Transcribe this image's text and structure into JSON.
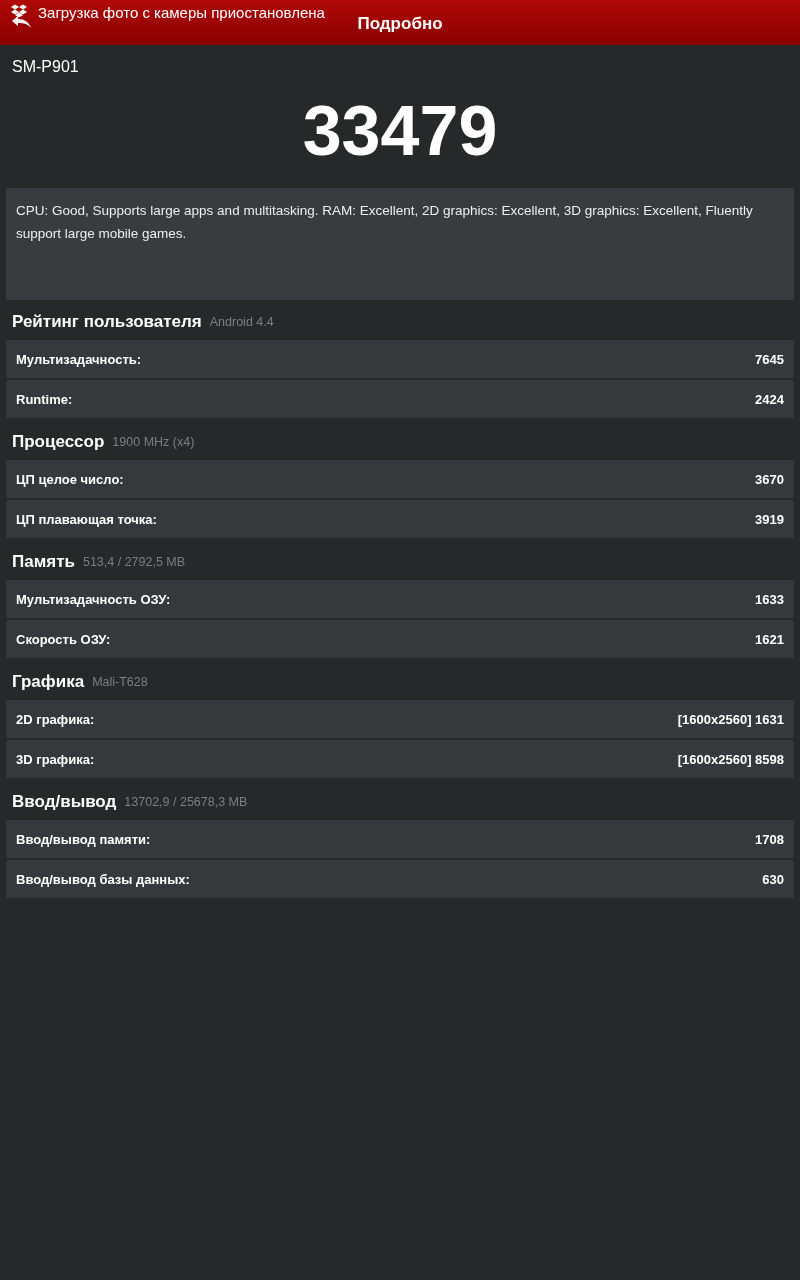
{
  "notification": {
    "text": "Загрузка фото с камеры приостановлена"
  },
  "header": {
    "title": "Подробно"
  },
  "device": "SM-P901",
  "score": "33479",
  "description": "CPU: Good, Supports large apps and multitasking. RAM: Excellent, 2D graphics: Excellent, 3D graphics: Excellent, Fluently support large mobile games.",
  "sections": [
    {
      "title": "Рейтинг пользователя",
      "subtitle": "Android 4.4",
      "rows": [
        {
          "label": "Мультизадачность:",
          "value": "7645"
        },
        {
          "label": "Runtime:",
          "value": "2424"
        }
      ]
    },
    {
      "title": "Процессор",
      "subtitle": "1900 MHz (x4)",
      "rows": [
        {
          "label": "ЦП целое число:",
          "value": "3670"
        },
        {
          "label": "ЦП плавающая точка:",
          "value": "3919"
        }
      ]
    },
    {
      "title": "Память",
      "subtitle": "513,4 / 2792,5 MB",
      "rows": [
        {
          "label": "Мультизадачность ОЗУ:",
          "value": "1633"
        },
        {
          "label": "Скорость ОЗУ:",
          "value": "1621"
        }
      ]
    },
    {
      "title": "Графика",
      "subtitle": "Mali-T628",
      "rows": [
        {
          "label": "2D графика:",
          "value": "[1600x2560] 1631"
        },
        {
          "label": "3D графика:",
          "value": "[1600x2560] 8598"
        }
      ]
    },
    {
      "title": "Ввод/вывод",
      "subtitle": "13702,9 / 25678,3 MB",
      "rows": [
        {
          "label": "Ввод/вывод памяти:",
          "value": "1708"
        },
        {
          "label": "Ввод/вывод базы данных:",
          "value": "630"
        }
      ]
    }
  ]
}
